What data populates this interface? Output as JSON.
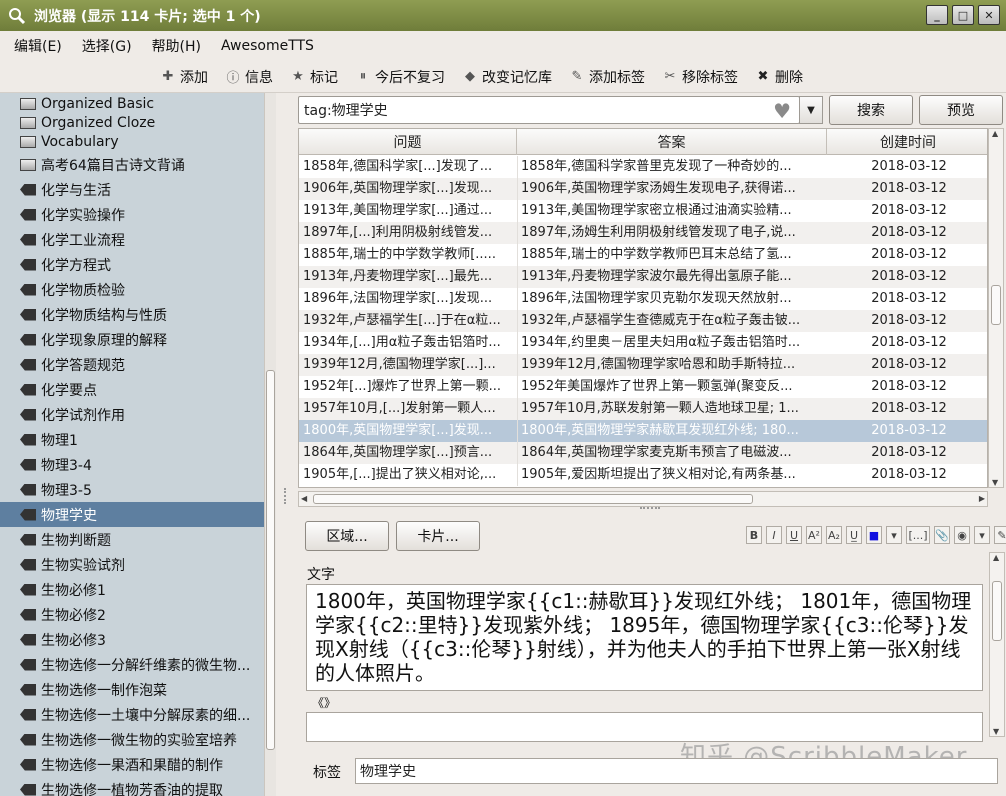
{
  "window": {
    "title": "浏览器 (显示 114 卡片; 选中 1 个)",
    "minimize": "_",
    "maximize": "□",
    "close": "✕"
  },
  "menu": [
    "编辑(E)",
    "选择(G)",
    "帮助(H)",
    "AwesomeTTS"
  ],
  "toolbar": [
    {
      "label": "添加",
      "icon": "add-icon"
    },
    {
      "label": "信息",
      "icon": "info-icon"
    },
    {
      "label": "标记",
      "icon": "star-icon"
    },
    {
      "label": "今后不复习",
      "icon": "suspend-icon"
    },
    {
      "label": "改变记忆库",
      "icon": "deck-icon"
    },
    {
      "label": "添加标签",
      "icon": "add-tag-icon"
    },
    {
      "label": "移除标签",
      "icon": "remove-tag-icon"
    },
    {
      "label": "删除",
      "icon": "delete-icon"
    }
  ],
  "sidebar": {
    "items": [
      {
        "label": "Organized Basic",
        "type": "deck"
      },
      {
        "label": "Organized Cloze",
        "type": "deck"
      },
      {
        "label": "Vocabulary",
        "type": "deck"
      },
      {
        "label": "高考64篇目古诗文背诵",
        "type": "deck"
      },
      {
        "label": "化学与生活",
        "type": "tag"
      },
      {
        "label": "化学实验操作",
        "type": "tag"
      },
      {
        "label": "化学工业流程",
        "type": "tag"
      },
      {
        "label": "化学方程式",
        "type": "tag"
      },
      {
        "label": "化学物质检验",
        "type": "tag"
      },
      {
        "label": "化学物质结构与性质",
        "type": "tag"
      },
      {
        "label": "化学现象原理的解释",
        "type": "tag"
      },
      {
        "label": "化学答题规范",
        "type": "tag"
      },
      {
        "label": "化学要点",
        "type": "tag"
      },
      {
        "label": "化学试剂作用",
        "type": "tag"
      },
      {
        "label": "物理1",
        "type": "tag"
      },
      {
        "label": "物理3-4",
        "type": "tag"
      },
      {
        "label": "物理3-5",
        "type": "tag"
      },
      {
        "label": "物理学史",
        "type": "tag",
        "selected": true
      },
      {
        "label": "生物判断题",
        "type": "tag"
      },
      {
        "label": "生物实验试剂",
        "type": "tag"
      },
      {
        "label": "生物必修1",
        "type": "tag"
      },
      {
        "label": "生物必修2",
        "type": "tag"
      },
      {
        "label": "生物必修3",
        "type": "tag"
      },
      {
        "label": "生物选修一分解纤维素的微生物...",
        "type": "tag"
      },
      {
        "label": "生物选修一制作泡菜",
        "type": "tag"
      },
      {
        "label": "生物选修一土壤中分解尿素的细...",
        "type": "tag"
      },
      {
        "label": "生物选修一微生物的实验室培养",
        "type": "tag"
      },
      {
        "label": "生物选修一果酒和果醋的制作",
        "type": "tag"
      },
      {
        "label": "生物选修一植物芳香油的提取",
        "type": "tag"
      }
    ]
  },
  "search": {
    "value": "tag:物理学史",
    "search_label": "搜索",
    "preview_label": "预览"
  },
  "table": {
    "columns": [
      "问题",
      "答案",
      "创建时间"
    ],
    "rows": [
      {
        "q": "1858年,德国科学家[...]发现了...",
        "a": "1858年,德国科学家普里克发现了一种奇妙的...",
        "date": "2018-03-12"
      },
      {
        "q": "1906年,英国物理学家[...]发现...",
        "a": "1906年,英国物理学家汤姆生发现电子,获得诺...",
        "date": "2018-03-12"
      },
      {
        "q": "1913年,美国物理学家[...]通过...",
        "a": "1913年,美国物理学家密立根通过油滴实验精...",
        "date": "2018-03-12"
      },
      {
        "q": "1897年,[...]利用阴极射线管发...",
        "a": "1897年,汤姆生利用阴极射线管发现了电子,说...",
        "date": "2018-03-12"
      },
      {
        "q": "1885年,瑞士的中学数学教师[.....",
        "a": "1885年,瑞士的中学数学教师巴耳末总结了氢...",
        "date": "2018-03-12"
      },
      {
        "q": "1913年,丹麦物理学家[...]最先...",
        "a": "1913年,丹麦物理学家波尔最先得出氢原子能...",
        "date": "2018-03-12"
      },
      {
        "q": "1896年,法国物理学家[...]发现...",
        "a": "1896年,法国物理学家贝克勒尔发现天然放射...",
        "date": "2018-03-12"
      },
      {
        "q": "1932年,卢瑟福学生[...]于在α粒...",
        "a": "1932年,卢瑟福学生查德威克于在α粒子轰击铍...",
        "date": "2018-03-12"
      },
      {
        "q": "1934年,[...]用α粒子轰击铝箔时...",
        "a": "1934年,约里奥－居里夫妇用α粒子轰击铝箔时...",
        "date": "2018-03-12"
      },
      {
        "q": "1939年12月,德国物理学家[...]...",
        "a": "1939年12月,德国物理学家哈恩和助手斯特拉...",
        "date": "2018-03-12"
      },
      {
        "q": "1952年[...]爆炸了世界上第一颗...",
        "a": "1952年美国爆炸了世界上第一颗氢弹(聚变反...",
        "date": "2018-03-12"
      },
      {
        "q": "1957年10月,[...]发射第一颗人...",
        "a": "1957年10月,苏联发射第一颗人造地球卫星; 1...",
        "date": "2018-03-12"
      },
      {
        "q": "1800年,英国物理学家[...]发现...",
        "a": "1800年,英国物理学家赫歇耳发现红外线; 180...",
        "date": "2018-03-12",
        "selected": true
      },
      {
        "q": "1864年,英国物理学家[...]预言...",
        "a": "1864年,英国物理学家麦克斯韦预言了电磁波...",
        "date": "2018-03-12"
      },
      {
        "q": "1905年,[...]提出了狭义相对论,...",
        "a": "1905年,爱因斯坦提出了狭义相对论,有两条基...",
        "date": "2018-03-12"
      }
    ]
  },
  "editor": {
    "fields_button": "区域...",
    "cards_button": "卡片...",
    "format_buttons": [
      "B",
      "I",
      "U",
      "A²",
      "A₂",
      "U̲",
      "■",
      "▾",
      "[...]",
      "📎",
      "◉",
      "▾",
      "✎"
    ],
    "text_label": "文字",
    "text_value": "1800年，英国物理学家{{c1::赫歇耳}}发现红外线；  1801年，德国物理学家{{c2::里特}}发现紫外线；  1895年，德国物理学家{{c3::伦琴}}发现X射线（{{c3::伦琴}}射线），并为他夫人的手拍下世界上第一张X射线的人体照片。",
    "second_label": "《》",
    "second_value": "",
    "tags_label": "标签",
    "tags_value": "物理学史"
  },
  "watermark": "知乎 @ScribbleMaker"
}
